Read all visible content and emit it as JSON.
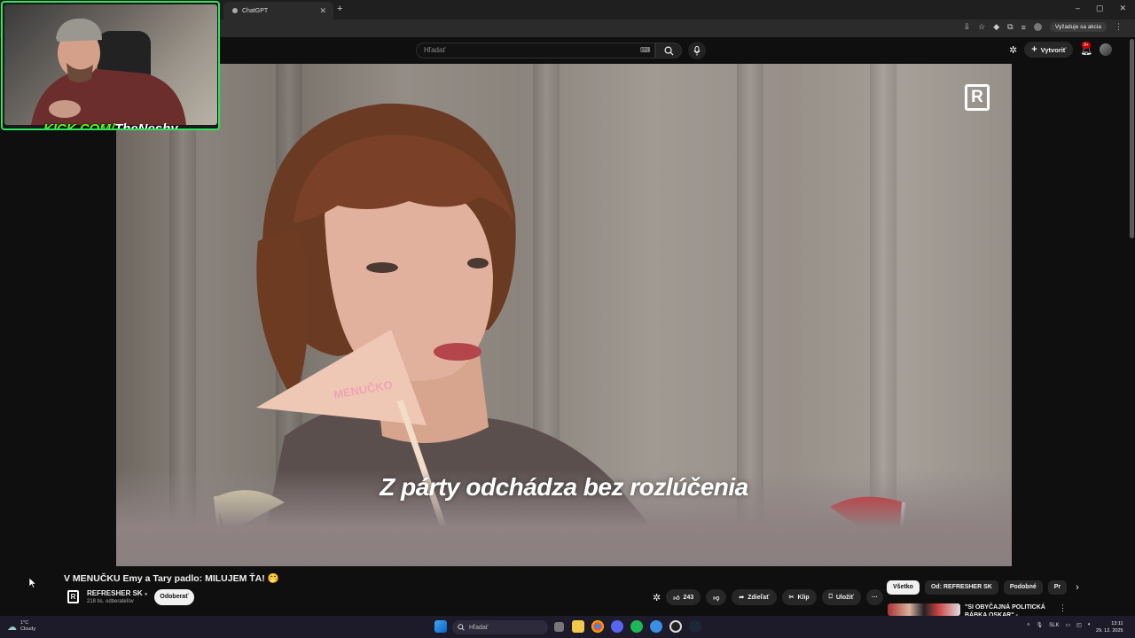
{
  "browser": {
    "tab_title": "ChatGPT",
    "new_tab": "+",
    "window_controls": [
      "–",
      "▢",
      "✕"
    ],
    "update_pill": "Vyžaduje sa akcia"
  },
  "youtube_header": {
    "search_placeholder": "Hľadať",
    "create_label": "Vytvoriť",
    "notifications_badge": "9+"
  },
  "video": {
    "caption": "Z párty odchádza bez rozlúčenia",
    "flag_text": "MENUČKO",
    "brand_logo": "R"
  },
  "webcam": {
    "label_site": "KICK.COM/",
    "label_name": "TheNeshy",
    "accent_color": "#53fc18"
  },
  "video_info": {
    "title": "V MENUČKU Emy a Tary padlo: MILUJEM ŤA! 🤭",
    "channel_name": "REFRESHER SK",
    "subscribers": "218 tis. odberateľov",
    "subscribe_label": "Odoberať",
    "likes": "243",
    "share_label": "Zdieľať",
    "clip_label": "Klip",
    "save_label": "Uložiť",
    "more_label": "···"
  },
  "chips": [
    "Všetko",
    "Od: REFRESHER SK",
    "Podobné",
    "Pr"
  ],
  "recommended": {
    "title": "\"SI OBYČAJNÁ POLITICKÁ BÁBKA OSKAR\" -"
  },
  "taskbar": {
    "weather_temp": "1°C",
    "weather_desc": "Cloudy",
    "search_placeholder": "Hľadať",
    "language": "SLK",
    "time": "13:11",
    "date": "29. 12. 2025"
  }
}
